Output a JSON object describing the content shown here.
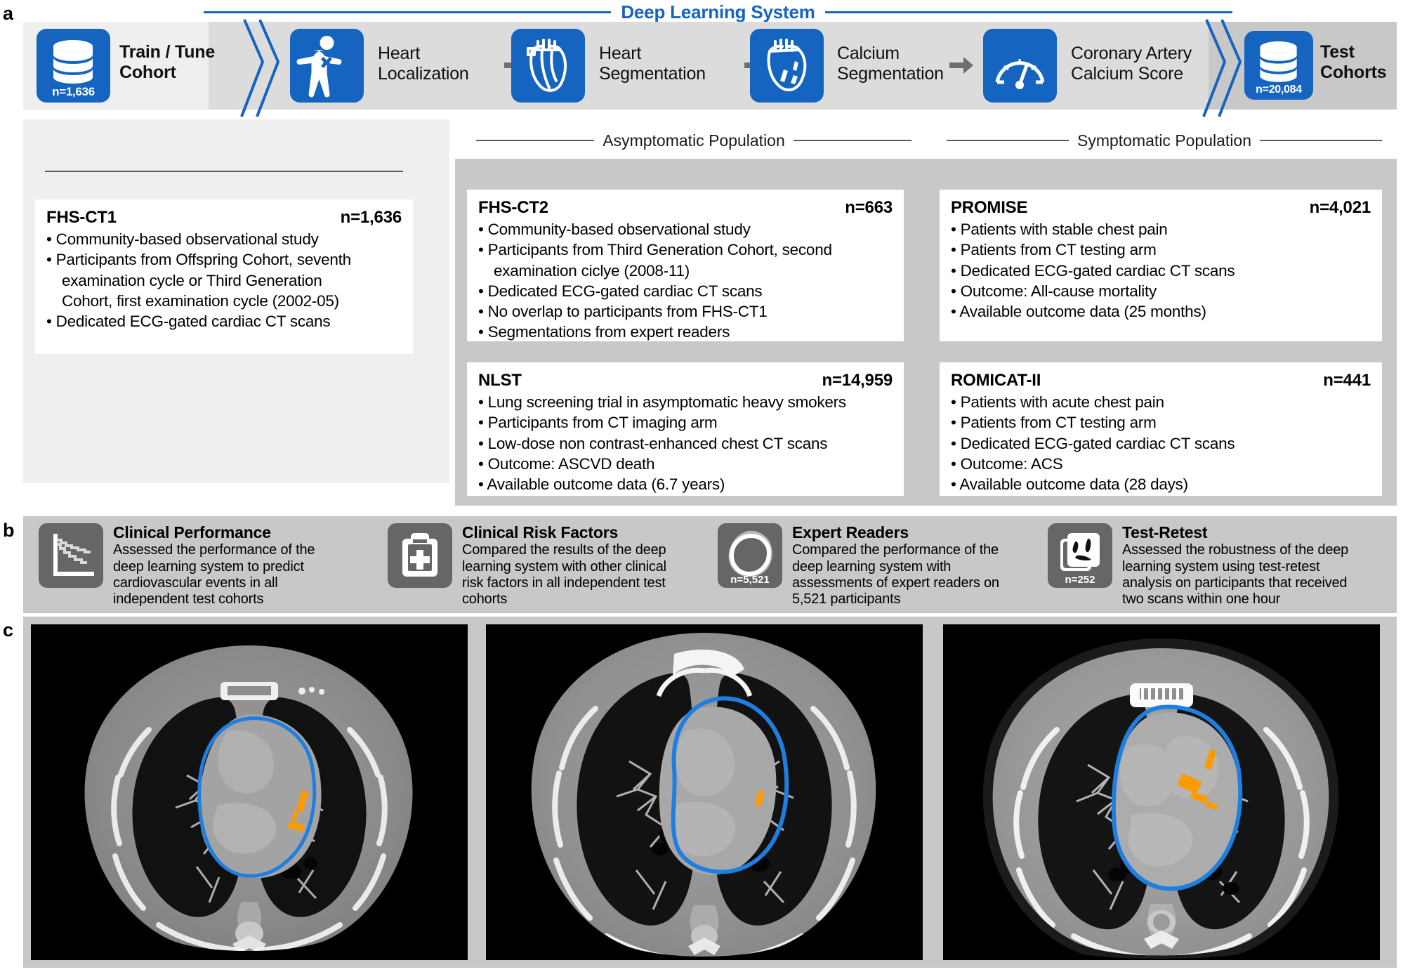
{
  "panels": {
    "a": "a",
    "b": "b",
    "c": "c"
  },
  "colors": {
    "brand_blue": "#1565c0",
    "segmentation_outline": "#1e7fe0",
    "calcium_highlight": "#ff9a00",
    "panel_gray_light": "#efefef",
    "panel_gray_mid": "#dcdcdc",
    "panel_gray_dark": "#c8c8c8",
    "tile_gray": "#666666"
  },
  "pipeline": {
    "title": "Deep Learning System",
    "train_cohort": {
      "icon": "database-icon",
      "n_label": "n=1,636",
      "label_line1": "Train / Tune",
      "label_line2": "Cohort"
    },
    "steps": [
      {
        "icon": "body-heart-localization-icon",
        "line1": "Heart",
        "line2": "Localization"
      },
      {
        "icon": "heart-anatomy-icon",
        "line1": "Heart",
        "line2": "Segmentation"
      },
      {
        "icon": "heart-calcium-icon",
        "line1": "Calcium",
        "line2": "Segmentation"
      },
      {
        "icon": "gauge-icon",
        "line1": "Coronary Artery",
        "line2": "Calcium Score"
      }
    ],
    "test_cohorts": {
      "icon": "database-icon",
      "n_label": "n=20,084",
      "label_line1": "Test",
      "label_line2": "Cohorts"
    }
  },
  "sections": {
    "train_rule_caption": "",
    "asymptomatic": "Asymptomatic Population",
    "symptomatic": "Symptomatic Population"
  },
  "studies": {
    "fhs_ct1": {
      "name": "FHS-CT1",
      "n": "n=1,636",
      "bullets": [
        {
          "text": "Community-based observational study",
          "cont": []
        },
        {
          "text": "Participants from Offspring Cohort, seventh",
          "cont": [
            "examination cycle or Third Generation",
            "Cohort, first examination cycle (2002-05)"
          ]
        },
        {
          "text": "Dedicated ECG-gated cardiac CT scans",
          "cont": []
        }
      ]
    },
    "fhs_ct2": {
      "name": "FHS-CT2",
      "n": "n=663",
      "bullets": [
        {
          "text": "Community-based observational study",
          "cont": []
        },
        {
          "text": "Participants from Third Generation Cohort, second",
          "cont": [
            "examination ciclye (2008-11)"
          ]
        },
        {
          "text": "Dedicated ECG-gated cardiac CT scans",
          "cont": []
        },
        {
          "text": "No overlap to participants from FHS-CT1",
          "cont": []
        },
        {
          "text": "Segmentations from expert readers",
          "cont": []
        }
      ]
    },
    "nlst": {
      "name": "NLST",
      "n": "n=14,959",
      "bullets": [
        {
          "text": "Lung screening trial in asymptomatic heavy smokers",
          "cont": []
        },
        {
          "text": "Participants from CT imaging arm",
          "cont": []
        },
        {
          "text": "Low-dose non contrast-enhanced chest CT scans",
          "cont": []
        },
        {
          "text": "Outcome: ASCVD death",
          "cont": []
        },
        {
          "text": "Available outcome data (6.7 years)",
          "cont": []
        }
      ]
    },
    "promise": {
      "name": "PROMISE",
      "n": "n=4,021",
      "bullets": [
        {
          "text": "Patients with stable chest pain",
          "cont": []
        },
        {
          "text": "Patients from CT testing arm",
          "cont": []
        },
        {
          "text": "Dedicated ECG-gated cardiac CT scans",
          "cont": []
        },
        {
          "text": "Outcome: All-cause mortality",
          "cont": []
        },
        {
          "text": "Available outcome data (25 months)",
          "cont": []
        }
      ]
    },
    "romicat_ii": {
      "name": "ROMICAT-II",
      "n": "n=441",
      "bullets": [
        {
          "text": "Patients with acute chest pain",
          "cont": []
        },
        {
          "text": "Patients from CT testing arm",
          "cont": []
        },
        {
          "text": "Dedicated ECG-gated cardiac CT scans",
          "cont": []
        },
        {
          "text": "Outcome: ACS",
          "cont": []
        },
        {
          "text": "Available outcome data (28 days)",
          "cont": []
        }
      ]
    }
  },
  "analyses": [
    {
      "icon": "survival-curve-icon",
      "n_label": "",
      "title": "Clinical Performance",
      "desc_lines": [
        "Assessed the performance of the",
        "deep learning system to predict",
        "cardiovascular events in all",
        "independent test cohorts"
      ]
    },
    {
      "icon": "clipboard-medical-icon",
      "n_label": "",
      "title": "Clinical Risk Factors",
      "desc_lines": [
        "Compared the results of the deep",
        "learning system with other clinical",
        "risk factors in all independent test",
        "cohorts"
      ]
    },
    {
      "icon": "contour-ring-icon",
      "n_label": "n=5,521",
      "title": "Expert Readers",
      "desc_lines": [
        "Compared the performance of the",
        "deep learning system with",
        "assessments of expert readers on",
        "5,521 participants"
      ]
    },
    {
      "icon": "two-scans-icon",
      "n_label": "n=252",
      "title": "Test-Retest",
      "desc_lines": [
        "Assessed the robustness of the deep",
        "learning system using test-retest",
        "analysis on participants that received",
        "two scans within one hour"
      ]
    }
  ],
  "ct_images": [
    {
      "name": "axial-chest-ct-1",
      "alt": "Axial chest CT with blue heart segmentation contour and orange coronary calcium"
    },
    {
      "name": "axial-chest-ct-2",
      "alt": "Axial chest CT with blue heart segmentation contour and orange coronary calcium"
    },
    {
      "name": "axial-chest-ct-3",
      "alt": "Axial chest CT with blue heart segmentation contour and orange coronary calcium"
    }
  ]
}
